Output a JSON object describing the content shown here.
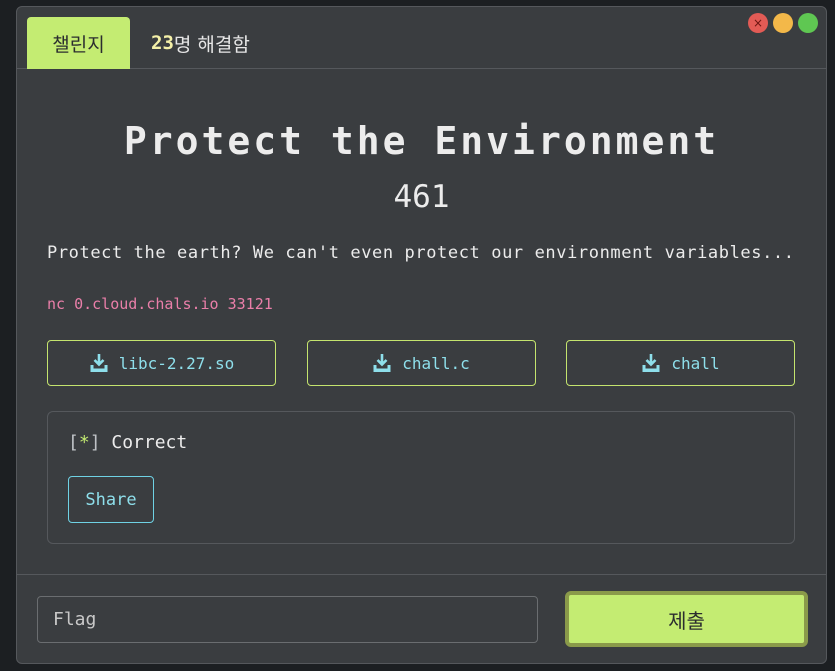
{
  "tabs": {
    "active_label": "챌린지",
    "solved_count": "23",
    "solved_suffix": "명 해결함"
  },
  "window_controls": {
    "close_glyph": "×",
    "icons": [
      "close-icon",
      "minimize-icon",
      "maximize-icon"
    ]
  },
  "challenge": {
    "title": "Protect the Environment",
    "points": "461",
    "description": "Protect the earth? We can't even protect our environment variables...",
    "connection": "nc 0.cloud.chals.io 33121"
  },
  "files": [
    {
      "label": "libc-2.27.so",
      "icon": "download-icon"
    },
    {
      "label": "chall.c",
      "icon": "download-icon"
    },
    {
      "label": "chall",
      "icon": "download-icon"
    }
  ],
  "result": {
    "bracket_open": "[",
    "star": "*",
    "bracket_close": "]",
    "message": "Correct",
    "share_label": "Share"
  },
  "submission": {
    "flag_placeholder": "Flag",
    "submit_label": "제출"
  },
  "colors": {
    "accent": "#c4ec72",
    "file_text": "#8edfeb",
    "connection_text": "#ea7fa9",
    "background": "#3a3d40"
  }
}
